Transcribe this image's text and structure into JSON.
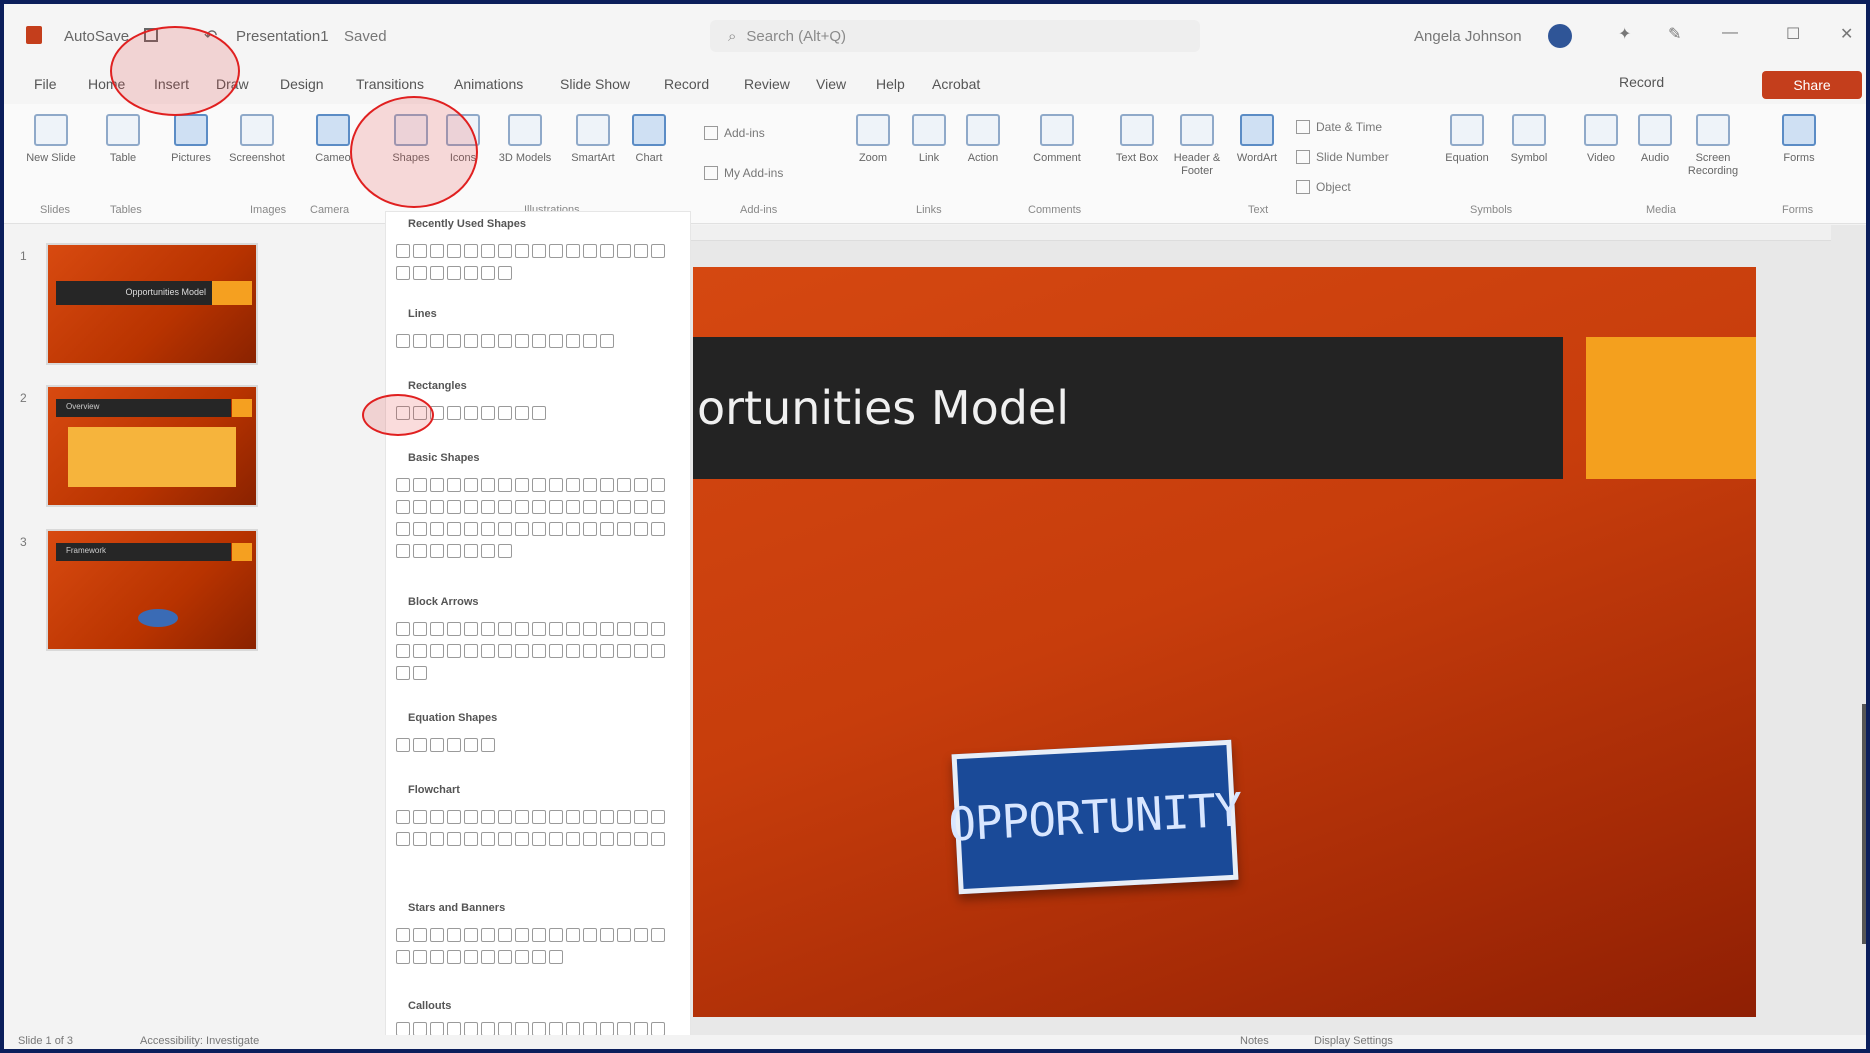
{
  "titlebar": {
    "autosave": "AutoSave",
    "filename": "Presentation1",
    "saved_status": "Saved",
    "search_placeholder": "Search (Alt+Q)",
    "user": "Angela Johnson"
  },
  "tabs": [
    "File",
    "Home",
    "Insert",
    "Draw",
    "Design",
    "Transitions",
    "Animations",
    "Slide Show",
    "Record",
    "Review",
    "View",
    "Help",
    "Acrobat"
  ],
  "actions": {
    "record": "Record",
    "share": "Share"
  },
  "ribbon": {
    "buttons": [
      "New Slide",
      "Table",
      "Pictures",
      "Screenshot",
      "Cameo",
      "Shapes",
      "Icons",
      "3D Models",
      "SmartArt",
      "Chart",
      "Zoom",
      "Link",
      "Action",
      "Comment",
      "Text Box",
      "Header & Footer",
      "WordArt",
      "Equation",
      "Symbol",
      "Video",
      "Audio",
      "Screen Recording",
      "Forms"
    ],
    "small_buttons": [
      "Add-ins",
      "My Add-ins",
      "Date & Time",
      "Slide Number",
      "Object"
    ],
    "groups": [
      "Slides",
      "Tables",
      "Images",
      "Camera",
      "Illustrations",
      "Add-ins",
      "Links",
      "Comments",
      "Text",
      "Symbols",
      "Media",
      "Forms"
    ]
  },
  "shapes_gallery": {
    "sections": [
      "Recently Used Shapes",
      "Lines",
      "Rectangles",
      "Basic Shapes",
      "Block Arrows",
      "Equation Shapes",
      "Flowchart",
      "Stars and Banners",
      "Callouts"
    ]
  },
  "slides": [
    {
      "number": "1",
      "title": "Opportunities Model"
    },
    {
      "number": "2",
      "title": "Overview"
    },
    {
      "number": "3",
      "title": "Framework"
    }
  ],
  "slide": {
    "title": "ortunities Model",
    "sign_text": "OPPORTUNITY"
  },
  "status": {
    "slide_count": "Slide 1 of 3",
    "accessibility": "Accessibility: Investigate",
    "notes": "Notes",
    "display": "Display Settings"
  },
  "colors": {
    "accent": "#c43e1c",
    "slide_orange": "#f4a01e",
    "slide_bar": "#232323",
    "annotation": "#e02020"
  }
}
